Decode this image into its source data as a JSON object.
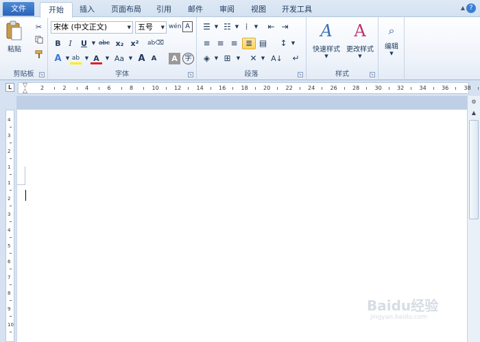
{
  "tabs": {
    "file": "文件",
    "home": "开始",
    "insert": "插入",
    "layout": "页面布局",
    "references": "引用",
    "mailings": "邮件",
    "review": "审阅",
    "view": "视图",
    "developer": "开发工具"
  },
  "clipboard": {
    "paste": "粘贴",
    "label": "剪贴板"
  },
  "font": {
    "face": "宋体 (中文正文)",
    "size": "五号",
    "label": "字体",
    "bold": "B",
    "italic": "I",
    "underline": "U",
    "strike": "abc",
    "sub": "x₂",
    "sup": "x²",
    "case": "Aa",
    "grow": "A",
    "shrink": "A",
    "clear_format": "A"
  },
  "paragraph": {
    "label": "段落"
  },
  "styles": {
    "quick": "快速样式",
    "change": "更改样式",
    "label": "样式"
  },
  "editing": {
    "label": "编辑"
  },
  "ruler": {
    "h_ticks": [
      "2",
      "2",
      "4",
      "6",
      "8",
      "10",
      "12",
      "14",
      "16",
      "18",
      "20",
      "22",
      "24",
      "26",
      "28",
      "30",
      "32",
      "34",
      "36",
      "38"
    ],
    "v_ticks": [
      "4",
      "3",
      "2",
      "1",
      "1",
      "2",
      "3",
      "4",
      "5",
      "6",
      "7",
      "8",
      "9",
      "10"
    ],
    "corner": "L"
  },
  "watermark": {
    "text": "Baidu经验",
    "sub": "jingyan.baidu.com"
  },
  "colors": {
    "accent": "#2a62b8",
    "ribbon": "#eef3fa",
    "selected": "#fbd35e"
  }
}
